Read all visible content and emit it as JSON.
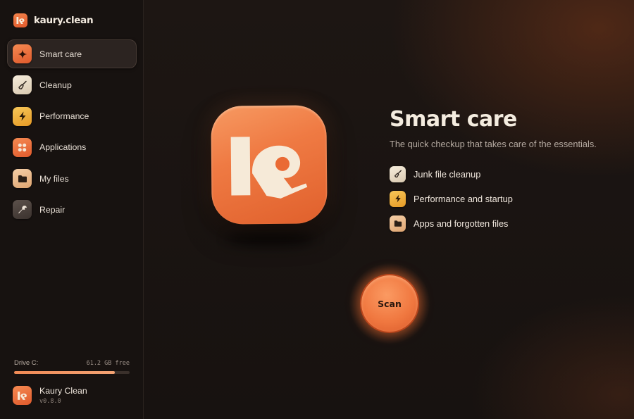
{
  "app": {
    "brand_name": "kaury.clean",
    "accent_color": "#ef7a43"
  },
  "sidebar": {
    "items": [
      {
        "label": "Smart care",
        "icon": "sparkle-icon",
        "active": true
      },
      {
        "label": "Cleanup",
        "icon": "broom-icon",
        "active": false
      },
      {
        "label": "Performance",
        "icon": "bolt-icon",
        "active": false
      },
      {
        "label": "Applications",
        "icon": "grid-icon",
        "active": false
      },
      {
        "label": "My files",
        "icon": "folder-icon",
        "active": false
      },
      {
        "label": "Repair",
        "icon": "wrench-icon",
        "active": false
      }
    ],
    "drive": {
      "label": "Drive C:",
      "free": "61.2 GB free",
      "used_fraction": 0.87
    },
    "profile": {
      "name": "Kaury Clean",
      "version": "v0.8.0"
    }
  },
  "main": {
    "title": "Smart care",
    "subtitle": "The quick checkup that takes care of the essentials.",
    "features": [
      {
        "label": "Junk file cleanup",
        "icon": "broom-icon"
      },
      {
        "label": "Performance and startup",
        "icon": "bolt-icon"
      },
      {
        "label": "Apps and forgotten files",
        "icon": "folder-icon"
      }
    ],
    "scan_label": "Scan"
  }
}
